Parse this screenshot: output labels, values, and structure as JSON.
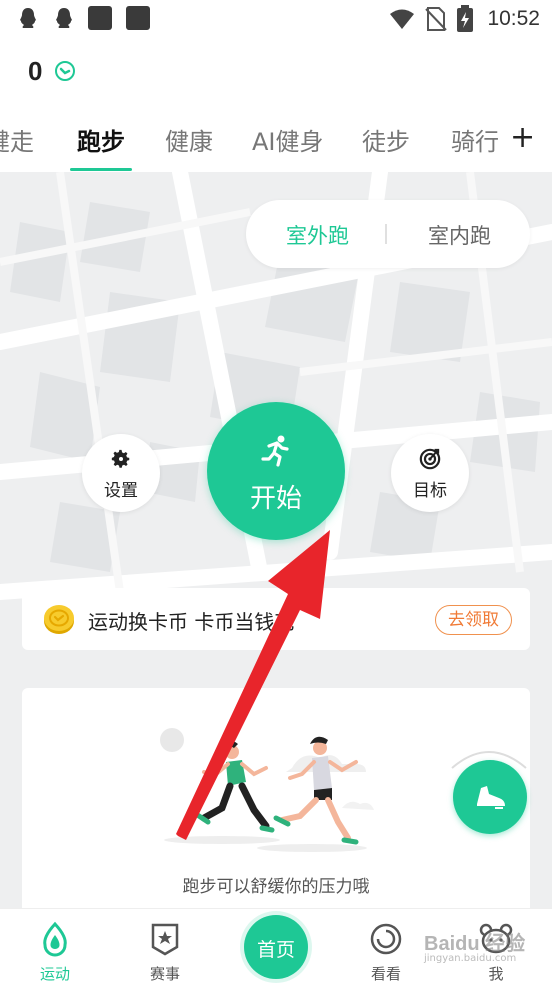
{
  "status_bar": {
    "time": "10:52",
    "left_icons": [
      "qq-icon",
      "qq-icon",
      "app-icon",
      "app-icon"
    ],
    "right_icons": [
      "wifi-icon",
      "no-sim-icon",
      "battery-charging-icon"
    ]
  },
  "header": {
    "coin_count": "0"
  },
  "tabs": [
    {
      "label": "健走"
    },
    {
      "label": "跑步"
    },
    {
      "label": "健康"
    },
    {
      "label": "AI健身"
    },
    {
      "label": "徒步"
    },
    {
      "label": "骑行"
    }
  ],
  "active_tab": 1,
  "add_tab_label": "+",
  "mode_switch": {
    "outdoor": "室外跑",
    "indoor": "室内跑",
    "selected": "室外跑"
  },
  "actions": {
    "settings": "设置",
    "start": "开始",
    "target": "目标"
  },
  "promo": {
    "text": "运动换卡币 卡币当钱花",
    "button": "去领取"
  },
  "illustration": {
    "caption": "跑步可以舒缓你的压力哦"
  },
  "bottom_nav": [
    {
      "label": "运动",
      "icon": "sport-drop-icon",
      "active": true
    },
    {
      "label": "赛事",
      "icon": "badge-star-icon"
    },
    {
      "label": "首页",
      "icon": "home-circle"
    },
    {
      "label": "看看",
      "icon": "swirl-icon"
    },
    {
      "label": "我",
      "icon": "bear-face-icon"
    }
  ],
  "watermark": {
    "text": "Baidu 经验",
    "sub": "jingyan.baidu.com"
  },
  "colors": {
    "accent": "#1ec895",
    "promo_button": "#f07a35",
    "annotation_arrow": "#e8252b"
  }
}
